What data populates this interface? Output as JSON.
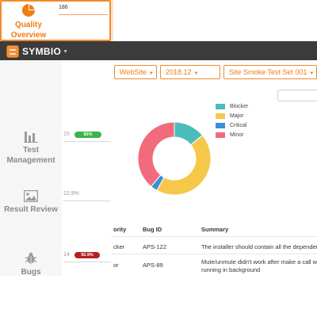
{
  "app": {
    "name": "SYMBIO"
  },
  "breadcrumbs": [
    {
      "label": "WebSite"
    },
    {
      "label": "2018.12"
    },
    {
      "label": "Site Smoke Test Set 001"
    }
  ],
  "sidebar": {
    "items": [
      {
        "label_line1": "Quality",
        "label_line2": "Overview",
        "stat": "186",
        "active": true,
        "icon": "pie-chart-icon"
      },
      {
        "label_line1": "Test",
        "label_line2": "Management",
        "stat": "15",
        "badge": "82%",
        "badge_color": "#3cb44b",
        "icon": "bar-chart-icon"
      },
      {
        "label_line1": "Result Review",
        "label_line2": "",
        "stat": "22.8%",
        "icon": "image-icon"
      },
      {
        "label_line1": "Bugs",
        "label_line2": "",
        "stat": "14",
        "badge": "92.9%",
        "badge_color": "#b32121",
        "icon": "bug-icon"
      }
    ]
  },
  "chart_data": {
    "type": "pie",
    "variant": "donut",
    "categories": [
      "Blocker",
      "Major",
      "Critical",
      "Minor"
    ],
    "values": [
      14,
      44,
      3,
      39
    ],
    "colors": [
      "#4dbdbb",
      "#f5c84a",
      "#3b8fd9",
      "#f26b7c"
    ],
    "legend": "right"
  },
  "table": {
    "columns": [
      "ority",
      "Bug ID",
      "Summary"
    ],
    "rows": [
      {
        "priority": "cker",
        "bug_id": "APS-122",
        "summary": "The installer should contain all the dependencies"
      },
      {
        "priority": "or",
        "bug_id": "APS-89",
        "summary": "Mute/unmute didn't work after make a call when",
        "summary2": "running in background"
      }
    ]
  },
  "colors": {
    "accent": "#ef7d13",
    "topbar": "#3b3b3b"
  }
}
